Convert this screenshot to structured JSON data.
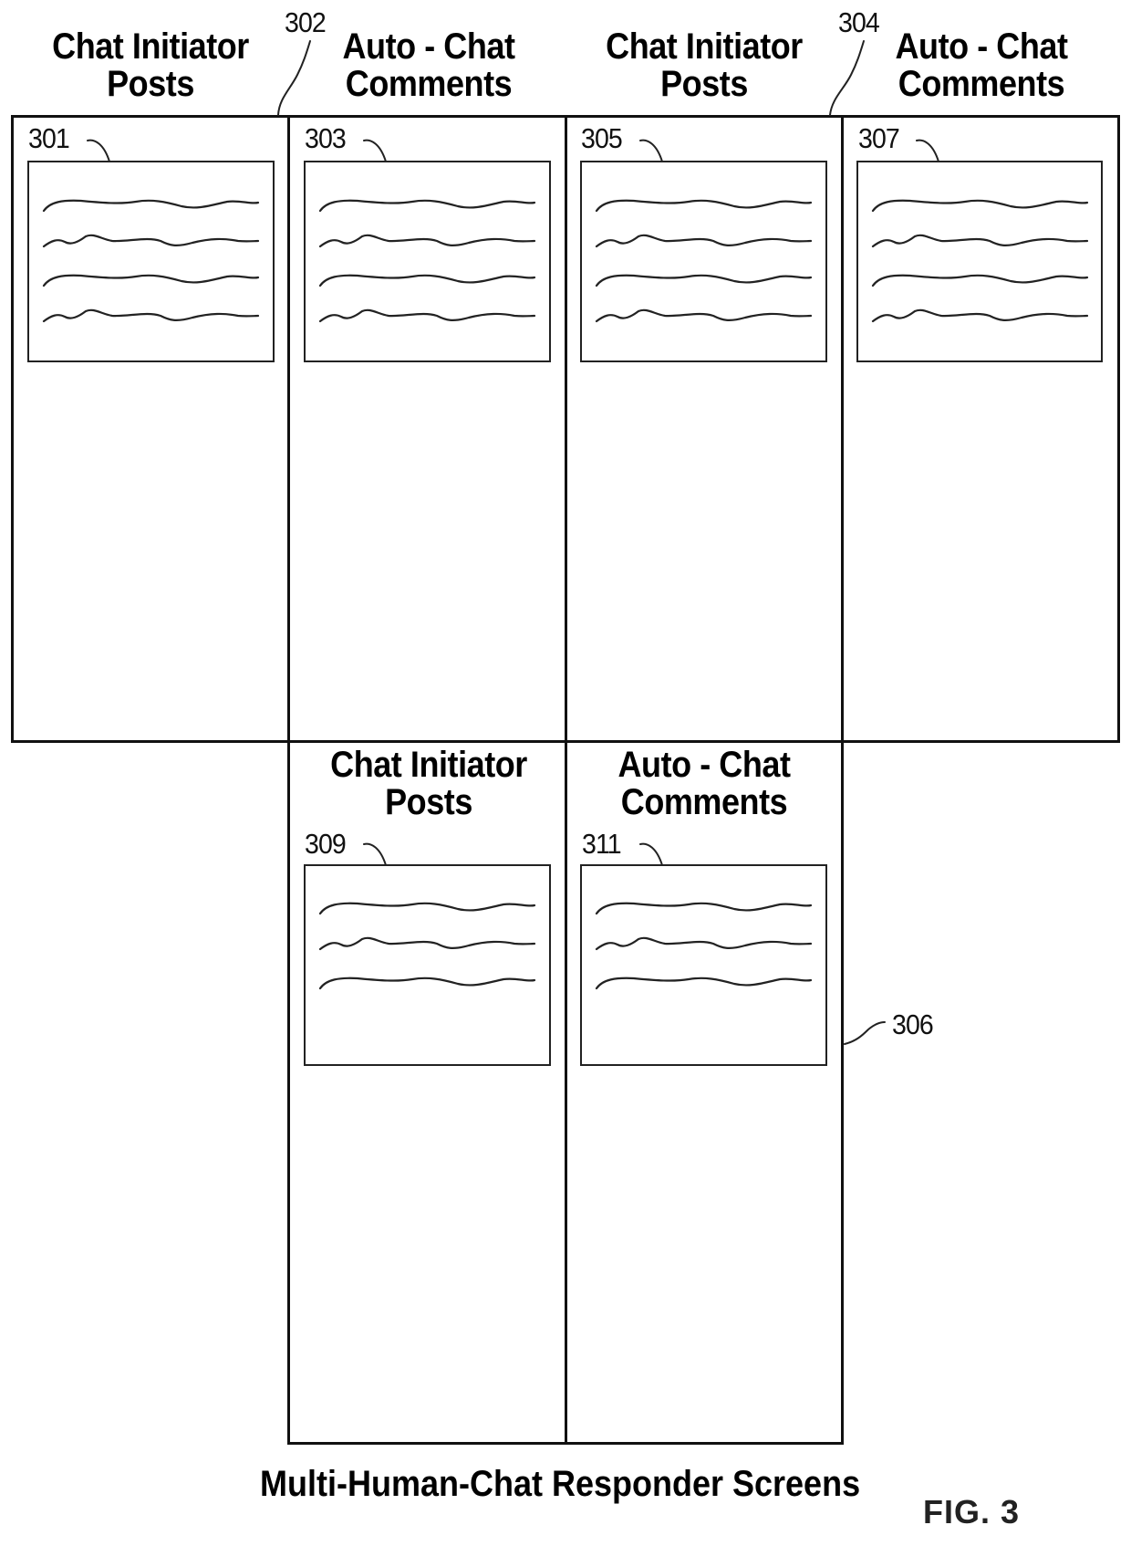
{
  "figure": {
    "caption": "Multi-Human-Chat Responder Screens",
    "fig_label": "FIG. 3"
  },
  "top_panel": {
    "columns": [
      {
        "heading_line1": "Chat Initiator",
        "heading_line2": "Posts",
        "box_ref": "301",
        "text_lines": 4
      },
      {
        "heading_line1": "Auto - Chat",
        "heading_line2": "Comments",
        "box_ref": "303",
        "text_lines": 4
      },
      {
        "heading_line1": "Chat Initiator",
        "heading_line2": "Posts",
        "box_ref": "305",
        "text_lines": 4
      },
      {
        "heading_line1": "Auto - Chat",
        "heading_line2": "Comments",
        "box_ref": "307",
        "text_lines": 4
      }
    ],
    "pair_refs": [
      "302",
      "304"
    ]
  },
  "bottom_panel": {
    "ref": "306",
    "columns": [
      {
        "heading_line1": "Chat Initiator",
        "heading_line2": "Posts",
        "box_ref": "309",
        "text_lines": 3
      },
      {
        "heading_line1": "Auto - Chat",
        "heading_line2": "Comments",
        "box_ref": "311",
        "text_lines": 3
      }
    ]
  },
  "colors": {
    "line": "#111111",
    "background": "#ffffff"
  }
}
